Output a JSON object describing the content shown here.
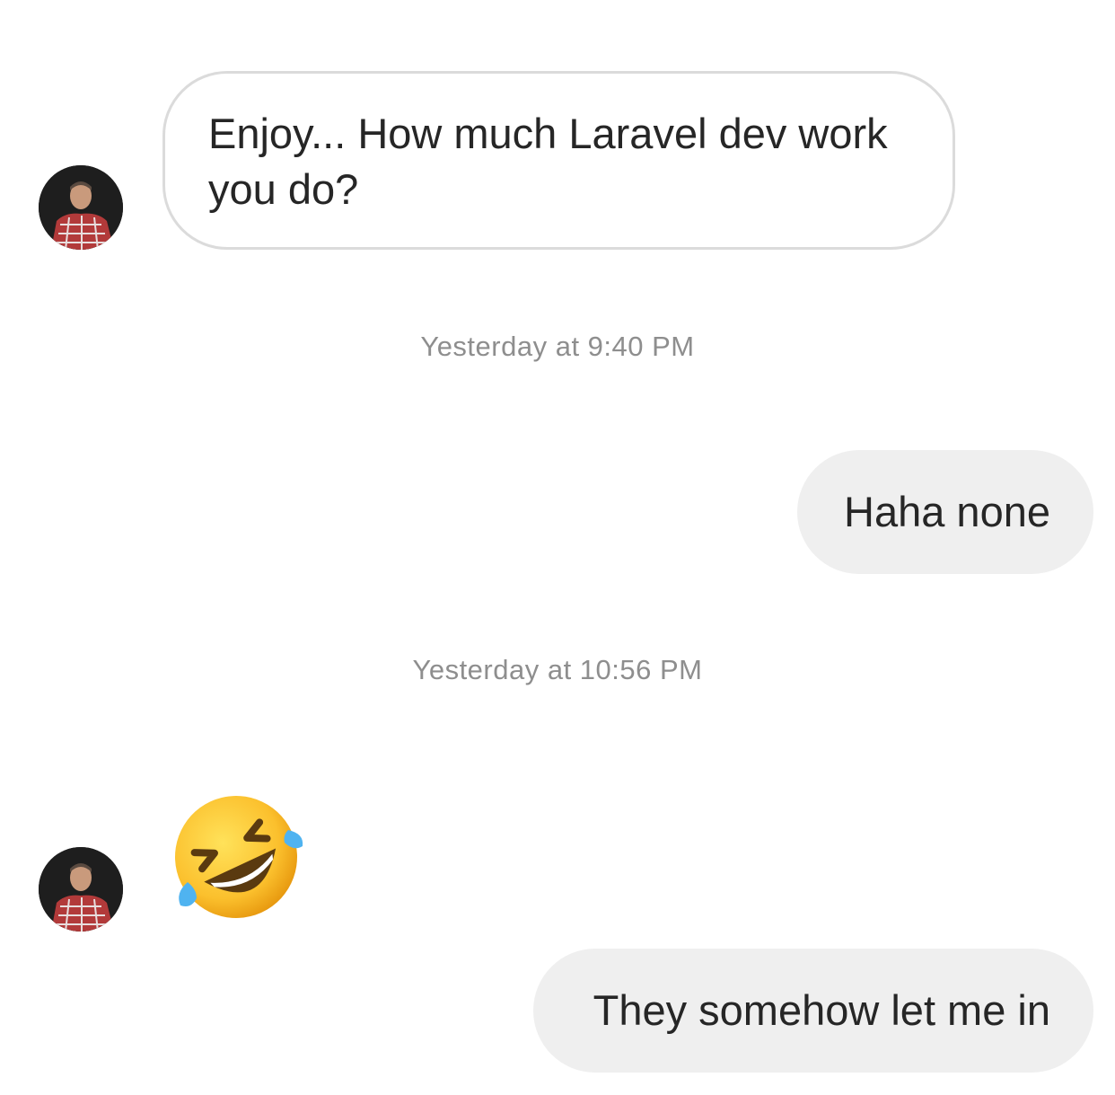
{
  "conversation": {
    "messages": [
      {
        "direction": "incoming",
        "text": "Enjoy... How much Laravel dev work you do?"
      },
      {
        "direction": "outgoing",
        "text": "Haha none"
      },
      {
        "direction": "incoming",
        "emoji": "rolling-on-the-floor-laughing"
      },
      {
        "direction": "outgoing",
        "text": "They somehow let me in"
      }
    ],
    "timestamps": [
      "Yesterday at 9:40 PM",
      "Yesterday at 10:56 PM"
    ]
  },
  "colors": {
    "incoming_bubble_border": "#dbdbdb",
    "outgoing_bubble_bg": "#efefef",
    "timestamp_text": "#8e8e8e",
    "message_text": "#262626"
  }
}
